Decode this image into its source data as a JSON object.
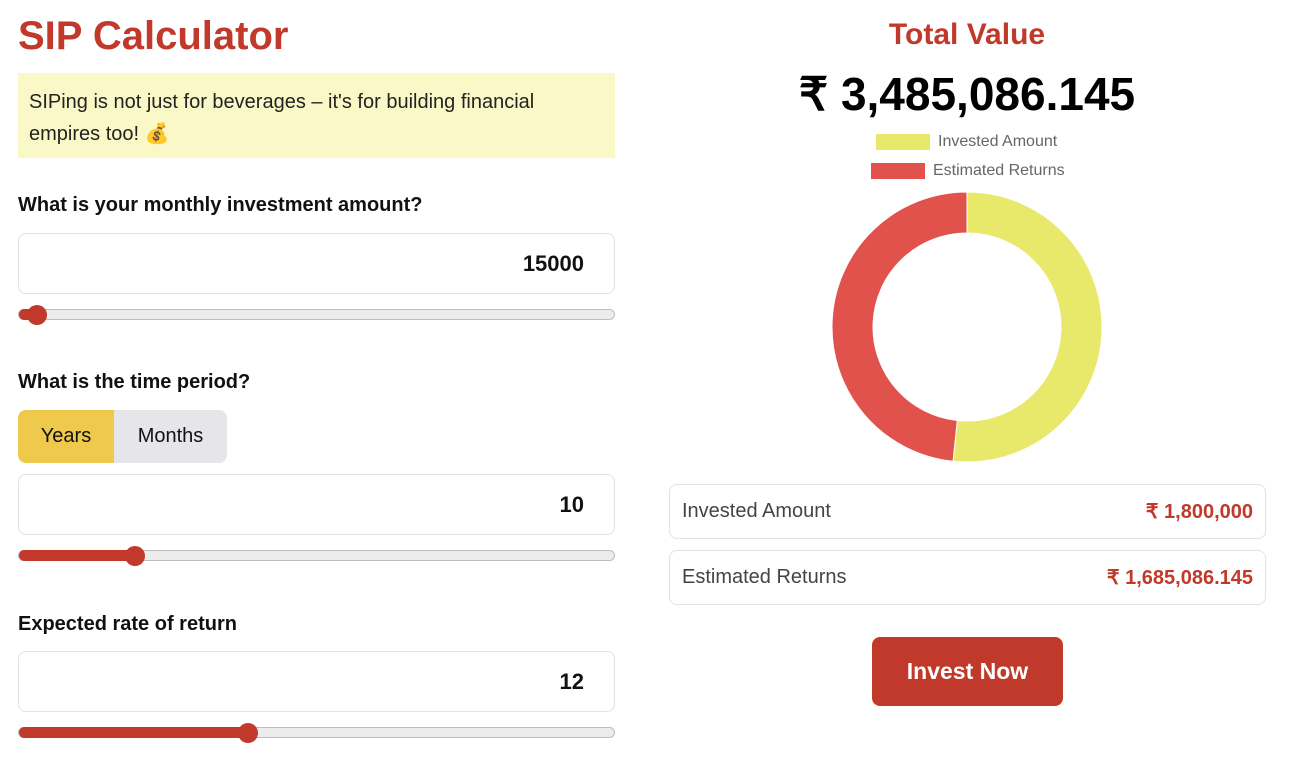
{
  "app": {
    "title": "SIP Calculator",
    "tagline": "SIPing is not just for beverages – it's for building financial empires too! 💰"
  },
  "monthly": {
    "question": "What is your monthly investment amount?",
    "value": "15000",
    "slider_fraction": 0.03
  },
  "period": {
    "question": "What is the time period?",
    "unit_options": [
      "Years",
      "Months"
    ],
    "selected_unit": "Years",
    "value": "10",
    "slider_fraction": 0.195
  },
  "rate": {
    "question": "Expected rate of return",
    "value": "12",
    "slider_fraction": 0.385
  },
  "result": {
    "total_label": "Total Value",
    "total_value": "₹ 3,485,086.145",
    "invested_label": "Invested Amount",
    "invested_value": "₹ 1,800,000",
    "returns_label": "Estimated Returns",
    "returns_value": "₹ 1,685,086.145"
  },
  "chart_data": {
    "type": "pie",
    "style": "doughnut",
    "legend_position": "top",
    "categories": [
      "Invested Amount",
      "Estimated Returns"
    ],
    "values": [
      1800000,
      1685086.145
    ],
    "colors": [
      "#e8e86b",
      "#e0524b"
    ]
  },
  "actions": {
    "invest_label": "Invest Now"
  },
  "colors": {
    "accent": "#c0392b",
    "toggle_active": "#efc94c",
    "tagline_bg": "#fbf8c7"
  }
}
